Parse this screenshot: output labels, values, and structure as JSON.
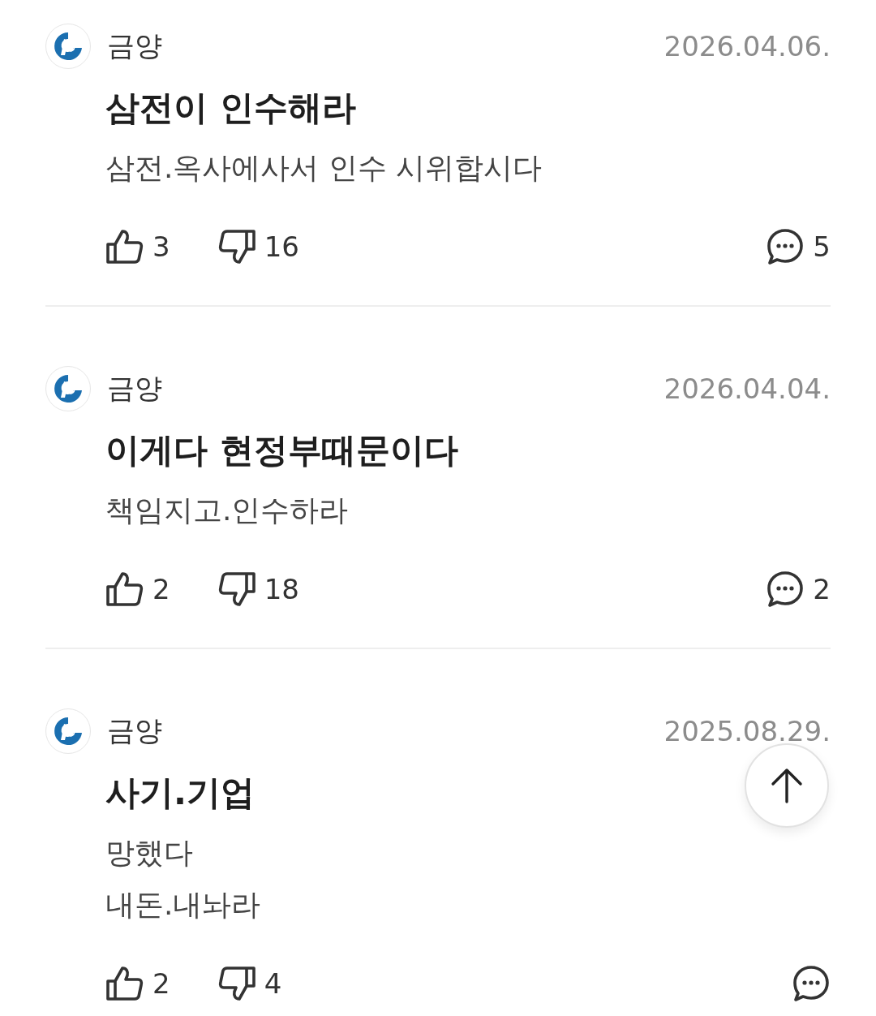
{
  "posts": [
    {
      "author": "금양",
      "date": "2026.04.06.",
      "title": "삼전이 인수해라",
      "body": "삼전.옥사에사서 인수 시위합시다",
      "likes": "3",
      "dislikes": "16",
      "comments": "5"
    },
    {
      "author": "금양",
      "date": "2026.04.04.",
      "title": "이게다 현정부때문이다",
      "body": "책임지고.인수하라",
      "likes": "2",
      "dislikes": "18",
      "comments": "2"
    },
    {
      "author": "금양",
      "date": "2025.08.29.",
      "title": "사기.기업",
      "body": "망했다\n내돈.내놔라",
      "likes": "2",
      "dislikes": "4"
    }
  ]
}
